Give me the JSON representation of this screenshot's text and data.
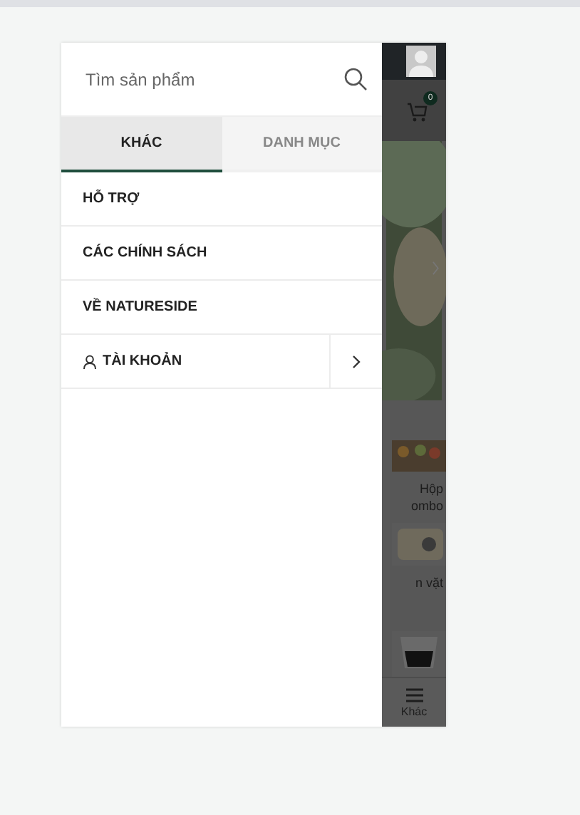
{
  "search": {
    "placeholder": "Tìm sản phẩm"
  },
  "tabs": [
    {
      "label": "KHÁC",
      "selected": true
    },
    {
      "label": "DANH MỤC",
      "selected": false
    }
  ],
  "menu_items": [
    {
      "kind": "link",
      "label": "HỖ TRỢ"
    },
    {
      "kind": "link",
      "label": "CÁC CHÍNH SÁCH"
    },
    {
      "kind": "link",
      "label": "VỀ NATURESIDE"
    },
    {
      "kind": "account",
      "label": "TÀI KHOẢN"
    }
  ],
  "background_page": {
    "cart_count": "0",
    "products": [
      {
        "label": "Hộp ombo"
      },
      {
        "label": "n vặt"
      }
    ],
    "bottom_nav_label": "Khác"
  }
}
